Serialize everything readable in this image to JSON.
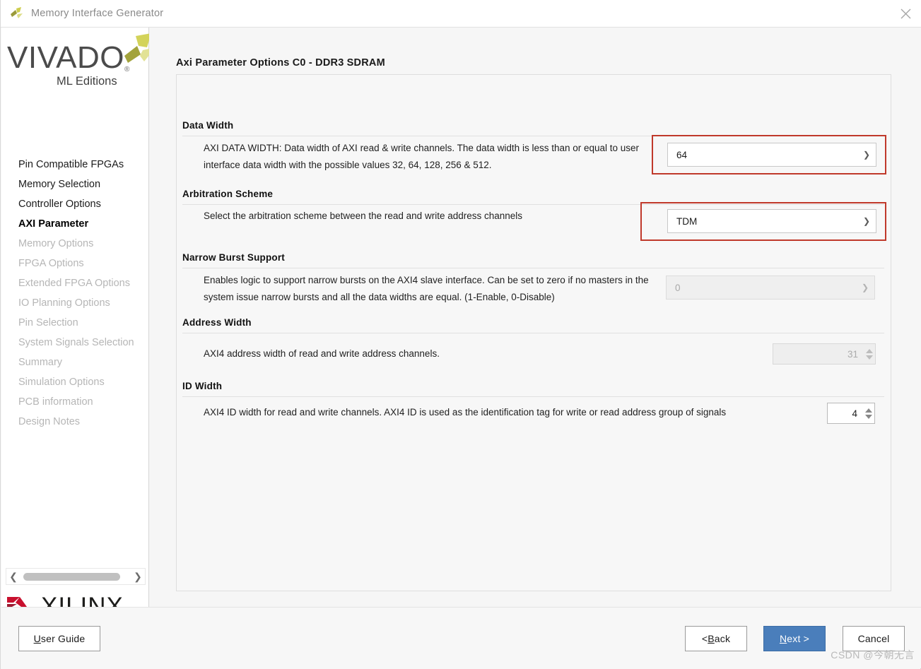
{
  "window": {
    "title": "Memory Interface Generator",
    "app_icon": "vivado-logo-icon",
    "close_icon": "close-icon"
  },
  "branding": {
    "vivado_word": "VIVADO",
    "vivado_reg": "®",
    "vivado_sub": "ML Editions",
    "xilinx_word": "XILINX",
    "xilinx_reg": "®",
    "xilinx_accent": "#c8102e",
    "vivado_accent": "#c8c832"
  },
  "sidebar": {
    "items": [
      {
        "label": "Pin Compatible FPGAs",
        "state": "done"
      },
      {
        "label": "Memory Selection",
        "state": "done"
      },
      {
        "label": "Controller Options",
        "state": "done"
      },
      {
        "label": "AXI Parameter",
        "state": "active"
      },
      {
        "label": "Memory Options",
        "state": "disabled"
      },
      {
        "label": "FPGA Options",
        "state": "disabled"
      },
      {
        "label": "Extended FPGA Options",
        "state": "disabled"
      },
      {
        "label": "IO Planning Options",
        "state": "disabled"
      },
      {
        "label": "Pin Selection",
        "state": "disabled"
      },
      {
        "label": "System Signals Selection",
        "state": "disabled"
      },
      {
        "label": "Summary",
        "state": "disabled"
      },
      {
        "label": "Simulation Options",
        "state": "disabled"
      },
      {
        "label": "PCB information",
        "state": "disabled"
      },
      {
        "label": "Design Notes",
        "state": "disabled"
      }
    ],
    "scroll_left_icon": "chevron-left-icon",
    "scroll_right_icon": "chevron-right-icon"
  },
  "main": {
    "page_title": "Axi Parameter Options C0 - DDR3 SDRAM",
    "sections": [
      {
        "heading": "Data Width",
        "description": "AXI DATA WIDTH: Data width of AXI read & write channels. The data width is less than or equal to user interface data width with the possible values 32, 64, 128, 256 & 512.",
        "control": "combo",
        "value": "64",
        "enabled": true,
        "highlighted": true
      },
      {
        "heading": "Arbitration Scheme",
        "description": "Select the arbitration scheme between the read and write address channels",
        "control": "combo",
        "value": "TDM",
        "enabled": true,
        "highlighted": true
      },
      {
        "heading": "Narrow Burst Support",
        "description": "Enables logic to support narrow bursts on the AXI4 slave interface. Can be set to zero if no masters in the system issue narrow bursts and all the data widths are equal. (1-Enable, 0-Disable)",
        "control": "combo",
        "value": "0",
        "enabled": false,
        "highlighted": false
      },
      {
        "heading": "Address Width",
        "description": "AXI4 address width of read and write address channels.",
        "control": "spinner",
        "value": "31",
        "enabled": false,
        "highlighted": false
      },
      {
        "heading": "ID Width",
        "description": "AXI4 ID width for read and write channels. AXI4 ID is used as the identification tag for write or read address group of signals",
        "control": "spinner",
        "value": "4",
        "enabled": true,
        "highlighted": false
      }
    ],
    "caret_icon": "chevron-down-icon",
    "annotation_color": "#c0392b"
  },
  "footer": {
    "user_guide": {
      "pre": "",
      "mnemonic": "U",
      "post": "ser Guide"
    },
    "back": {
      "pre": "< ",
      "mnemonic": "B",
      "post": "ack"
    },
    "next": {
      "pre": "",
      "mnemonic": "N",
      "post": "ext >"
    },
    "cancel": {
      "pre": "",
      "mnemonic": "",
      "post": "Cancel"
    },
    "next_color": "#4a7ebb"
  },
  "watermark": {
    "text": "CSDN @今朝无言"
  }
}
